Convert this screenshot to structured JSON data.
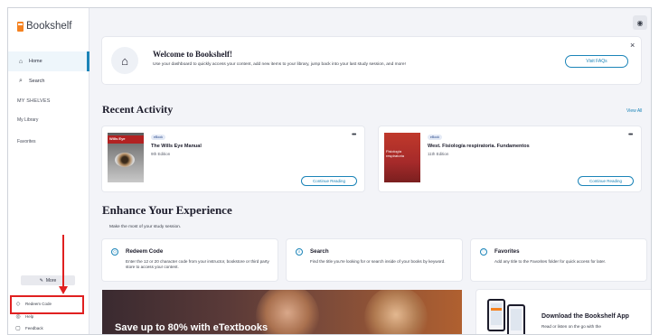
{
  "sidebar": {
    "logo": "Bookshelf",
    "nav": [
      {
        "label": "Home",
        "icon": "home-icon"
      },
      {
        "label": "Search",
        "icon": "search-icon"
      }
    ],
    "shelves_header": "MY SHELVES",
    "shelves": [
      "My Library",
      "Favorites"
    ],
    "more_label": "More",
    "bottom": [
      {
        "label": "Redeem Code",
        "icon": "tag-icon"
      },
      {
        "label": "Help",
        "icon": "help-icon"
      },
      {
        "label": "Feedback",
        "icon": "feedback-icon"
      }
    ]
  },
  "welcome": {
    "title": "Welcome to Bookshelf!",
    "text": "Use your dashboard to quickly access your content, add new items to your library, jump back into your last study session, and more!",
    "button": "Visit FAQs"
  },
  "recent": {
    "title": "Recent Activity",
    "view_all": "View All",
    "continue_label": "Continue Reading",
    "books": [
      {
        "badge": "eBook",
        "title": "The Wills Eye Manual",
        "edition": "9th Edition",
        "cover_text": "Wills Eye"
      },
      {
        "badge": "eBook",
        "title": "West. Fisiología respiratoria. Fundamentos",
        "edition": "11th Edition",
        "cover_text": "Fisiología respiratoria"
      }
    ]
  },
  "enhance": {
    "title": "Enhance Your Experience",
    "subtitle": "Make the most of your study session.",
    "features": [
      {
        "title": "Redeem Code",
        "icon": "tag-icon",
        "text": "Enter the 12 or 20 character code from your instructor, bookstore or third party store to access your content."
      },
      {
        "title": "Search",
        "icon": "search-icon",
        "text": "Find the title you're looking for or search inside of your books by keyword."
      },
      {
        "title": "Favorites",
        "icon": "heart-icon",
        "text": "Add any title to the Favorites folder for quick access for later."
      }
    ]
  },
  "promo": {
    "text": "Save up to 80% with eTextbooks"
  },
  "app_promo": {
    "title": "Download the Bookshelf App",
    "text": "Read or listen on the go with the"
  },
  "colors": {
    "accent": "#1b84b8",
    "brand": "#f58220",
    "highlight": "#e02020"
  }
}
